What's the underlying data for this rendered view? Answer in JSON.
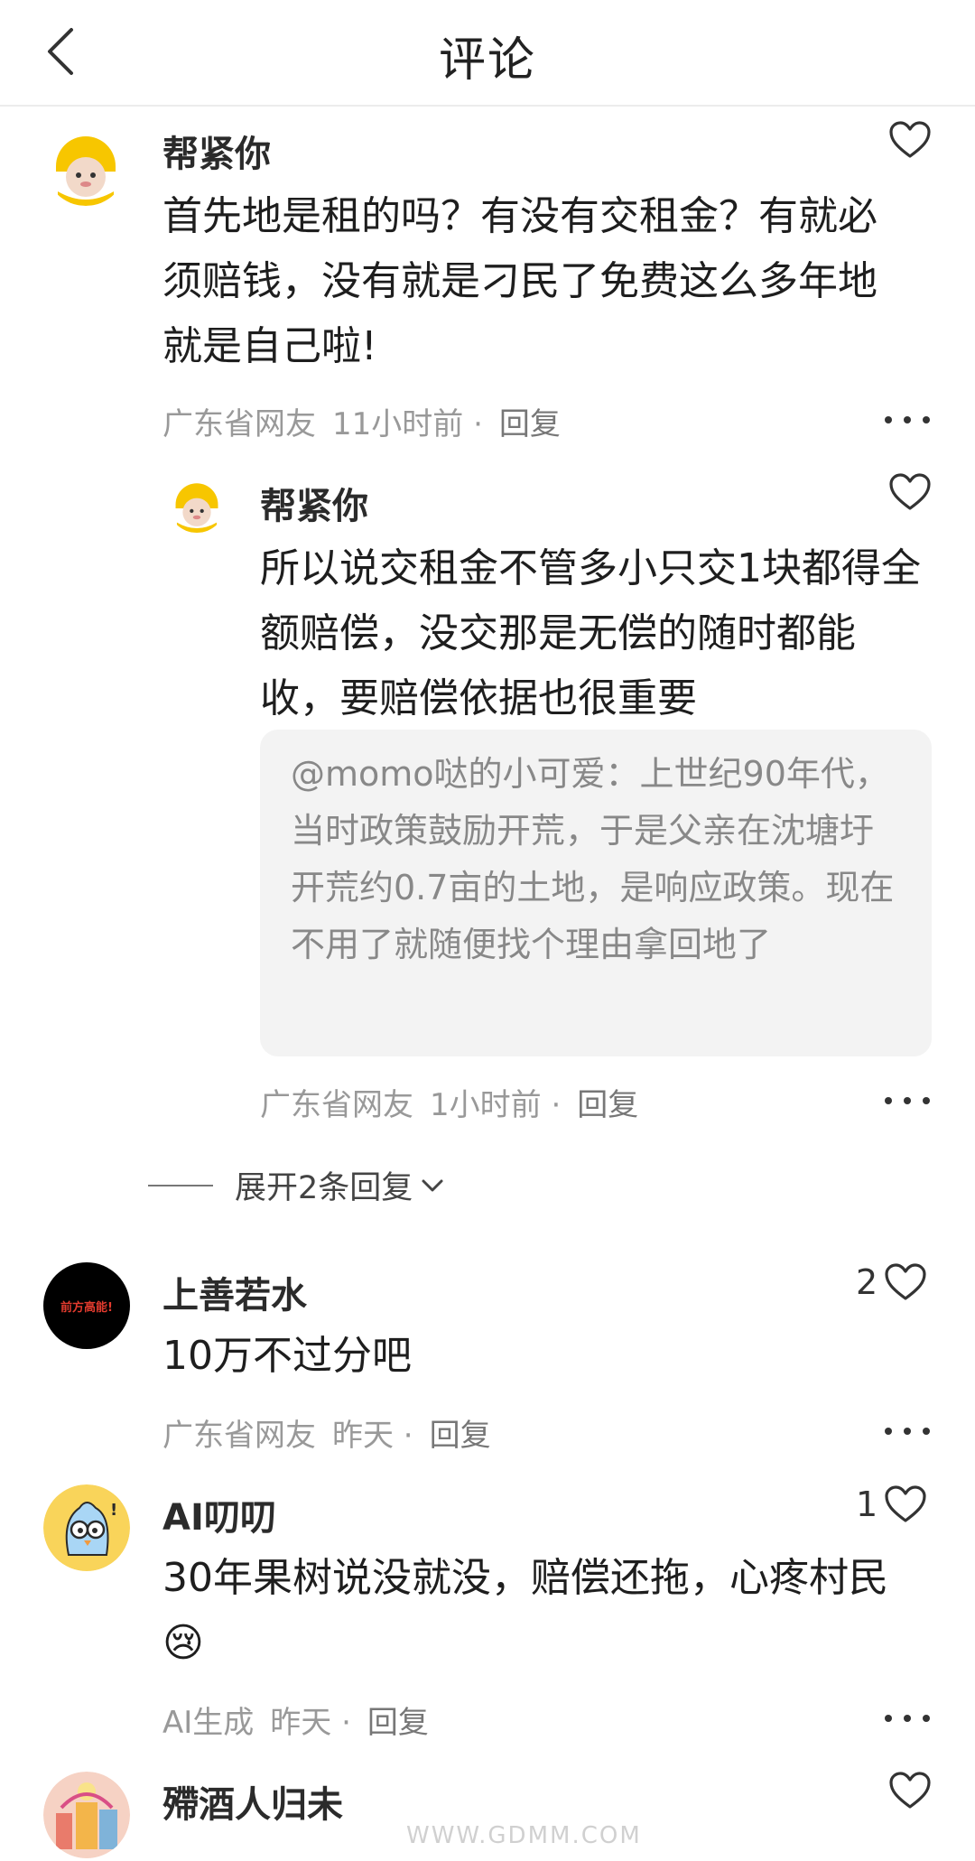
{
  "header": {
    "title": "评论"
  },
  "comments": [
    {
      "username": "帮紧你",
      "text": "首先地是租的吗？有没有交租金？有就必须赔钱，没有就是刁民了免费这么多年地就是自己啦!",
      "location": "广东省网友",
      "time": "11小时前 ·",
      "reply_label": "回复",
      "likes": ""
    },
    {
      "username": "帮紧你",
      "text": "所以说交租金不管多小只交1块都得全额赔偿，没交那是无偿的随时都能收，要赔偿依据也很重要",
      "quote": "@momo哒的小可爱：上世纪90年代，当时政策鼓励开荒，于是父亲在沈塘圩开荒约0.7亩的土地，是响应政策。现在不用了就随便找个理由拿回地了",
      "location": "广东省网友",
      "time": "1小时前 ·",
      "reply_label": "回复",
      "likes": ""
    },
    {
      "username": "上善若水",
      "avatar_text": "前方高能!",
      "text": "10万不过分吧",
      "location": "广东省网友",
      "time": "昨天 ·",
      "reply_label": "回复",
      "likes": "2"
    },
    {
      "username": "AI叨叨",
      "text": "30年果树说没就没，赔偿还拖，心疼村民😢",
      "location": "AI生成",
      "time": "昨天 ·",
      "reply_label": "回复",
      "likes": "1"
    },
    {
      "username": "殢酒人归未",
      "likes": ""
    }
  ],
  "expand_replies": {
    "label": "展开2条回复"
  },
  "watermark": "WWW.GDMM.COM",
  "colors": {
    "heart_stroke": "#333333",
    "avatar_yellow": "#f7c600",
    "quote_bg": "#f3f3f3"
  }
}
